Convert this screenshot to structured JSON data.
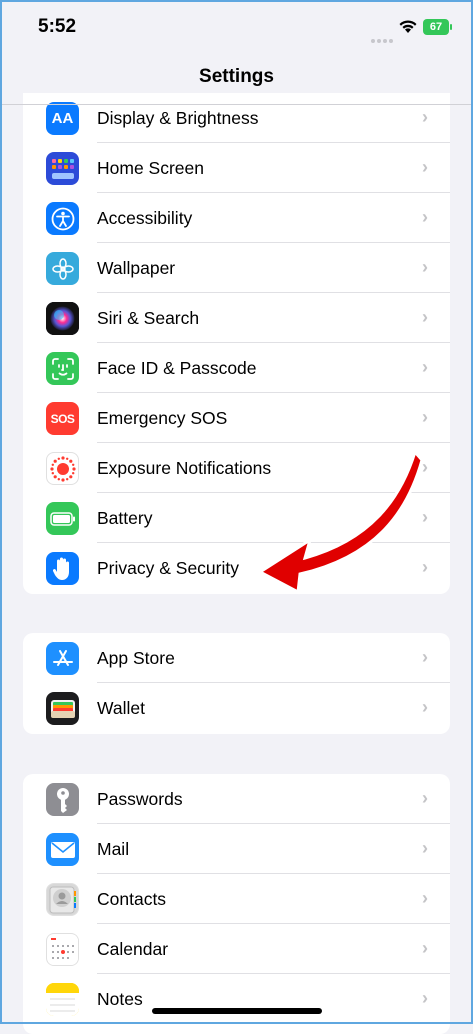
{
  "status_bar": {
    "time": "5:52",
    "battery": "67"
  },
  "nav": {
    "title": "Settings"
  },
  "groups": [
    {
      "rows": [
        {
          "label": "Display & Brightness",
          "icon": "display-brightness-icon",
          "color": "#0a7aff"
        },
        {
          "label": "Home Screen",
          "icon": "home-screen-icon",
          "color": "#2c4bd8"
        },
        {
          "label": "Accessibility",
          "icon": "accessibility-icon",
          "color": "#0a7aff"
        },
        {
          "label": "Wallpaper",
          "icon": "wallpaper-icon",
          "color": "#36aadc"
        },
        {
          "label": "Siri & Search",
          "icon": "siri-icon",
          "color": "#1a1a2e"
        },
        {
          "label": "Face ID & Passcode",
          "icon": "face-id-icon",
          "color": "#34c759"
        },
        {
          "label": "Emergency SOS",
          "icon": "emergency-sos-icon",
          "color": "#ff3b30"
        },
        {
          "label": "Exposure Notifications",
          "icon": "exposure-icon",
          "color": "#ffffff"
        },
        {
          "label": "Battery",
          "icon": "battery-icon",
          "color": "#34c759"
        },
        {
          "label": "Privacy & Security",
          "icon": "hand-icon",
          "color": "#0a7aff"
        }
      ]
    },
    {
      "rows": [
        {
          "label": "App Store",
          "icon": "app-store-icon",
          "color": "#1e90ff"
        },
        {
          "label": "Wallet",
          "icon": "wallet-icon",
          "color": "#1c1c1e"
        }
      ]
    },
    {
      "rows": [
        {
          "label": "Passwords",
          "icon": "key-icon",
          "color": "#8e8e93"
        },
        {
          "label": "Mail",
          "icon": "mail-icon",
          "color": "#1e90ff"
        },
        {
          "label": "Contacts",
          "icon": "contacts-icon",
          "color": "#d8d8d8"
        },
        {
          "label": "Calendar",
          "icon": "calendar-icon",
          "color": "#ffffff"
        },
        {
          "label": "Notes",
          "icon": "notes-icon",
          "color": "#ffd60a"
        }
      ]
    }
  ],
  "sos_text": "SOS"
}
